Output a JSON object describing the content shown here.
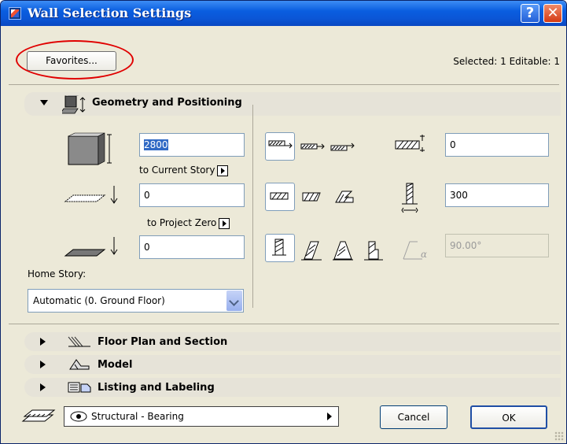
{
  "window": {
    "title": "Wall Selection Settings",
    "help_glyph": "?",
    "close_glyph": "✕"
  },
  "header": {
    "favorites_label": "Favorites...",
    "selection_info": "Selected: 1 Editable: 1"
  },
  "geometry": {
    "title": "Geometry and Positioning",
    "height_value": "2800",
    "top_link_label": "to Current Story",
    "base_offset_value": "0",
    "base_link_label": "to Project Zero",
    "bottom_value": "0",
    "home_story_label": "Home Story:",
    "home_story_value": "Automatic (0. Ground Floor)",
    "ref_offset_value": "0",
    "thickness_value": "300",
    "angle_value": "90.00°",
    "angle_symbol": "α"
  },
  "sections": [
    {
      "label": "Floor Plan and Section",
      "icon": "floor-plan-icon"
    },
    {
      "label": "Model",
      "icon": "model-icon"
    },
    {
      "label": "Listing and Labeling",
      "icon": "listing-icon"
    }
  ],
  "footer": {
    "layer_value": "Structural - Bearing",
    "cancel_label": "Cancel",
    "ok_label": "OK"
  },
  "colors": {
    "accent": "#0a5ee0",
    "highlight": "#316ac5",
    "annotation": "#e00000"
  }
}
